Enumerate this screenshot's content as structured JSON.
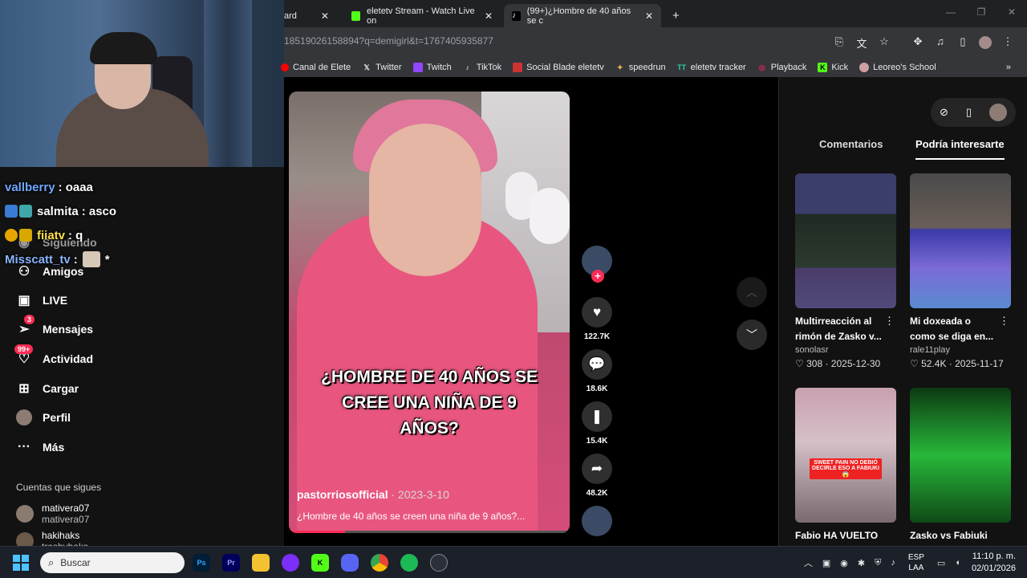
{
  "browser": {
    "tabs": [
      {
        "label": "ard",
        "active": false
      },
      {
        "label": "eletetv Stream - Watch Live on",
        "active": false
      },
      {
        "label": "(99+)¿Hombre de 40 años se c",
        "active": true
      }
    ],
    "url": "18519026158894?q=demigirl&t=1767405935877",
    "bookmarks": [
      "Canal de Elete",
      "Twitter",
      "Twitch",
      "TikTok",
      "Social Blade eletetv",
      "speedrun",
      "eletetv tracker",
      "Playback",
      "Kick",
      "Leoreo's School"
    ]
  },
  "chat": [
    {
      "user": "vallberry",
      "message": ": oaaa",
      "color": "#6fa8ff"
    },
    {
      "user": "salmita",
      "message": ": asco",
      "color": "#ffffff"
    },
    {
      "user": "fiiatv",
      "message": ": q",
      "color": "#ffffff"
    },
    {
      "user": "Misscatt_tv",
      "message": ":",
      "suffix": "*",
      "color": "#8ab4ff"
    }
  ],
  "sidebar": {
    "items": [
      {
        "label": "Siguiendo",
        "dim": true
      },
      {
        "label": "Amigos"
      },
      {
        "label": "LIVE"
      },
      {
        "label": "Mensajes",
        "badge": "3"
      },
      {
        "label": "Actividad",
        "badge": "99+"
      },
      {
        "label": "Cargar"
      },
      {
        "label": "Perfil"
      },
      {
        "label": "Más"
      }
    ],
    "following_title": "Cuentas que sigues",
    "following": [
      {
        "name": "mativera07",
        "handle": "mativera07"
      },
      {
        "name": "hakihaks",
        "handle": "trashyhaks"
      }
    ]
  },
  "video": {
    "caption": "¿HOMBRE DE 40 AÑOS SE CREE UNA NIÑA DE 9 AÑOS?",
    "author": "pastorriosofficial",
    "date": "· 2023-3-10",
    "description": "¿Hombre de 40 años se creen una niña de 9 años?...",
    "progress": 0.2
  },
  "actions": {
    "likes": "122.7K",
    "comments": "18.6K",
    "saves": "15.4K",
    "shares": "48.2K"
  },
  "panel": {
    "tabs": [
      "Comentarios",
      "Podría interesarte"
    ],
    "active_tab": 1,
    "cards": [
      {
        "title": "Multirreacción al rimón de Zasko v...",
        "author": "sonolasr",
        "likes": "♡ 308",
        "date": "2025-12-30"
      },
      {
        "title": "Mi doxeada o como se diga en...",
        "author": "rale11play",
        "likes": "♡ 52.4K",
        "date": "2025-11-17"
      },
      {
        "title": "Fabio HA VUELTO",
        "thumb_text": "SWEET PAIN NO DEBIÓ DECIRLE ESO A FABIUKI 😱"
      },
      {
        "title": "Zasko vs Fabiuki"
      }
    ]
  },
  "taskbar": {
    "search_placeholder": "Buscar",
    "lang1": "ESP",
    "lang2": "LAA",
    "time": "11:10 p. m.",
    "date": "02/01/2026"
  }
}
